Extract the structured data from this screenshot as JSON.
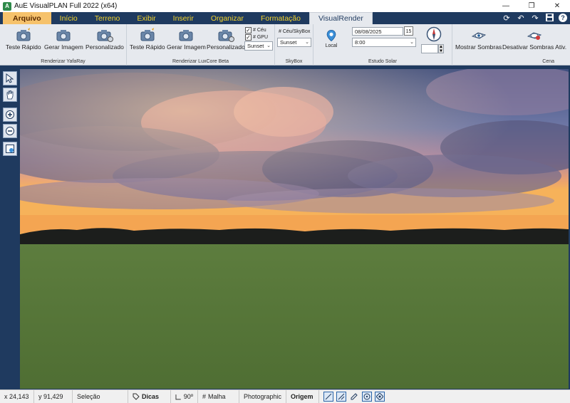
{
  "window": {
    "title": "AuE VisualPLAN Full 2022 (x64)",
    "app_icon_letter": "A",
    "minimize": "—",
    "maximize": "❐",
    "close": "✕"
  },
  "tabs": [
    {
      "label": "Arquivo"
    },
    {
      "label": "Início"
    },
    {
      "label": "Terreno"
    },
    {
      "label": "Exibir"
    },
    {
      "label": "Inserir"
    },
    {
      "label": "Organizar"
    },
    {
      "label": "Formatação"
    },
    {
      "label": "VisualRender"
    }
  ],
  "active_tab": "VisualRender",
  "quick_access": {
    "refresh": "⟳",
    "undo": "↶",
    "redo": "↷",
    "save": "💾",
    "help": "?"
  },
  "ribbon": {
    "yafaray": {
      "group_label": "Renderizar YafaRay",
      "buttons": [
        {
          "label": "Teste Rápido"
        },
        {
          "label": "Gerar Imagem"
        },
        {
          "label": "Personalizado"
        }
      ]
    },
    "luxcore": {
      "group_label": "Renderizar LuxCore Beta",
      "buttons": [
        {
          "label": "Teste Rápido"
        },
        {
          "label": "Gerar Imagem"
        },
        {
          "label": "Personalizado"
        }
      ],
      "checkbox_ceu": "# Céu",
      "checkbox_gpu": "# GPU",
      "preset": "Sunset"
    },
    "skybox": {
      "group_label": "SkyBox",
      "caption": "# Céu/SkyBox",
      "preset": "Sunset"
    },
    "estudo_solar": {
      "group_label": "Estudo Solar",
      "local_label": "Local",
      "date": "08/08/2025",
      "calendar_day": "15",
      "time": "8:00"
    },
    "cena": {
      "group_label": "Cena",
      "buttons": [
        {
          "label": "Mostrar Sombras"
        },
        {
          "label": "Desativar Sombras Ativ."
        }
      ]
    }
  },
  "status": {
    "x": "x 24,143",
    "y": "y 91,429",
    "selecao": "Seleção",
    "dicas": "Dicas",
    "angle": "90º",
    "malha": "Malha",
    "style": "Photographic",
    "origem": "Origem"
  },
  "colors": {
    "chrome": "#1f3a5f",
    "tab_text": "#f2d32c",
    "file_tab": "#f6c26b",
    "ribbon_bg": "#e6e9ee",
    "grass": "#5a7a3e",
    "sky_top": "#4a5a86",
    "sunset": "#f39a4c"
  }
}
